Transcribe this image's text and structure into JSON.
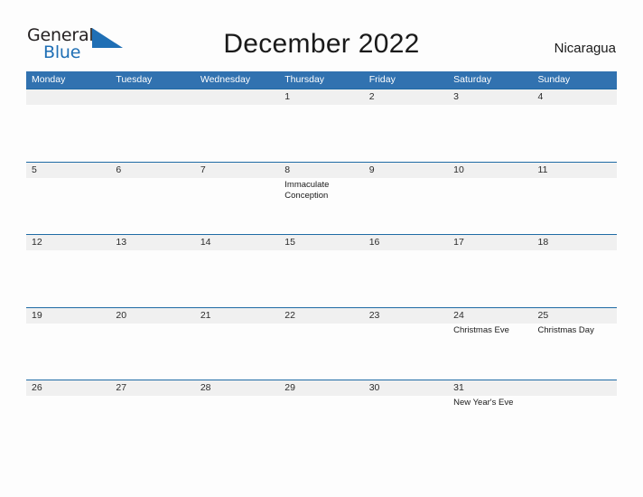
{
  "brand": {
    "name_part1": "General",
    "name_part2": "Blue",
    "triangle_icon": "triangle-flag-icon",
    "color_dark": "#231f20",
    "color_blue": "#1f6fb5"
  },
  "header": {
    "title": "December 2022",
    "country": "Nicaragua"
  },
  "colors": {
    "header_blue": "#3172b0",
    "row_divider_blue": "#1f6ba5",
    "daynum_band_gray": "#f0f0f0",
    "page_background": "#fdfdfd",
    "text_dark": "#1a1a1a"
  },
  "calendar": {
    "weekdays": [
      "Monday",
      "Tuesday",
      "Wednesday",
      "Thursday",
      "Friday",
      "Saturday",
      "Sunday"
    ],
    "weeks": [
      [
        {
          "day": "",
          "events": []
        },
        {
          "day": "",
          "events": []
        },
        {
          "day": "",
          "events": []
        },
        {
          "day": "1",
          "events": []
        },
        {
          "day": "2",
          "events": []
        },
        {
          "day": "3",
          "events": []
        },
        {
          "day": "4",
          "events": []
        }
      ],
      [
        {
          "day": "5",
          "events": []
        },
        {
          "day": "6",
          "events": []
        },
        {
          "day": "7",
          "events": []
        },
        {
          "day": "8",
          "events": [
            "Immaculate Conception"
          ]
        },
        {
          "day": "9",
          "events": []
        },
        {
          "day": "10",
          "events": []
        },
        {
          "day": "11",
          "events": []
        }
      ],
      [
        {
          "day": "12",
          "events": []
        },
        {
          "day": "13",
          "events": []
        },
        {
          "day": "14",
          "events": []
        },
        {
          "day": "15",
          "events": []
        },
        {
          "day": "16",
          "events": []
        },
        {
          "day": "17",
          "events": []
        },
        {
          "day": "18",
          "events": []
        }
      ],
      [
        {
          "day": "19",
          "events": []
        },
        {
          "day": "20",
          "events": []
        },
        {
          "day": "21",
          "events": []
        },
        {
          "day": "22",
          "events": []
        },
        {
          "day": "23",
          "events": []
        },
        {
          "day": "24",
          "events": [
            "Christmas Eve"
          ]
        },
        {
          "day": "25",
          "events": [
            "Christmas Day"
          ]
        }
      ],
      [
        {
          "day": "26",
          "events": []
        },
        {
          "day": "27",
          "events": []
        },
        {
          "day": "28",
          "events": []
        },
        {
          "day": "29",
          "events": []
        },
        {
          "day": "30",
          "events": []
        },
        {
          "day": "31",
          "events": [
            "New Year's Eve"
          ]
        },
        {
          "day": "",
          "events": []
        }
      ]
    ]
  }
}
